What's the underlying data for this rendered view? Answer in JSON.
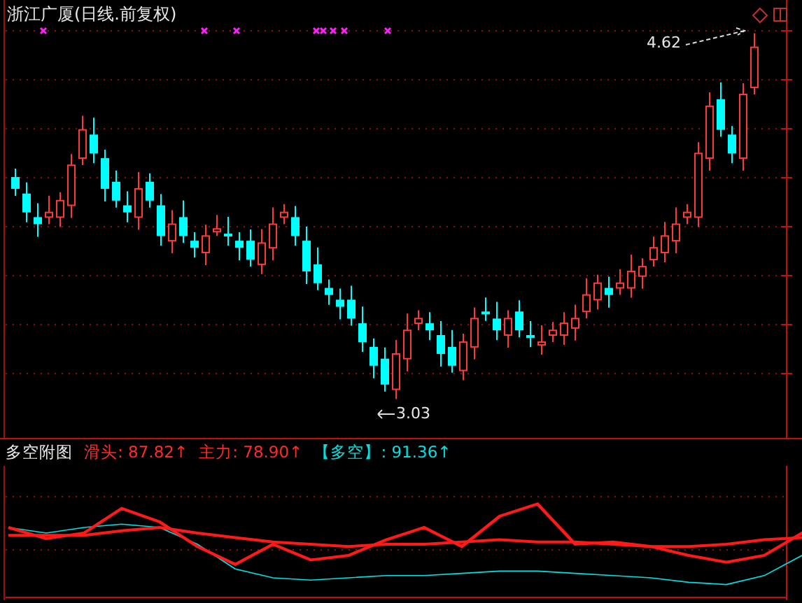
{
  "chart": {
    "title": "浙江广厦(日线.前复权)",
    "high_label": "4.62",
    "low_label": "3.03"
  },
  "indicator": {
    "name": "多空附图",
    "values": [
      {
        "text": "滑头: 87.82↑",
        "color": "#ff2a2a"
      },
      {
        "text": "主力: 78.90↑",
        "color": "#ff2a2a"
      },
      {
        "text": "【多空】: 91.36↑",
        "color": "#00e0e0"
      }
    ]
  }
}
